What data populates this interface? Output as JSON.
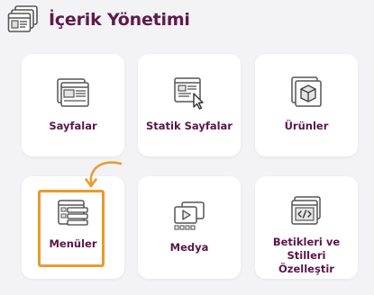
{
  "header": {
    "title": "İçerik Yönetimi",
    "icon": "browser-windows-icon"
  },
  "cards": [
    {
      "label": "Sayfalar",
      "icon": "pages-icon"
    },
    {
      "label": "Statik Sayfalar",
      "icon": "static-page-cursor-icon"
    },
    {
      "label": "Ürünler",
      "icon": "product-box-icon"
    },
    {
      "label": "Menüler",
      "icon": "menu-list-icon"
    },
    {
      "label": "Medya",
      "icon": "media-icon"
    },
    {
      "label": "Betikleri ve Stilleri Özelleştir",
      "icon": "code-window-icon"
    }
  ],
  "colors": {
    "title": "#5f1a4c",
    "highlight": "#e99a2f",
    "background": "#f3f3f5"
  }
}
